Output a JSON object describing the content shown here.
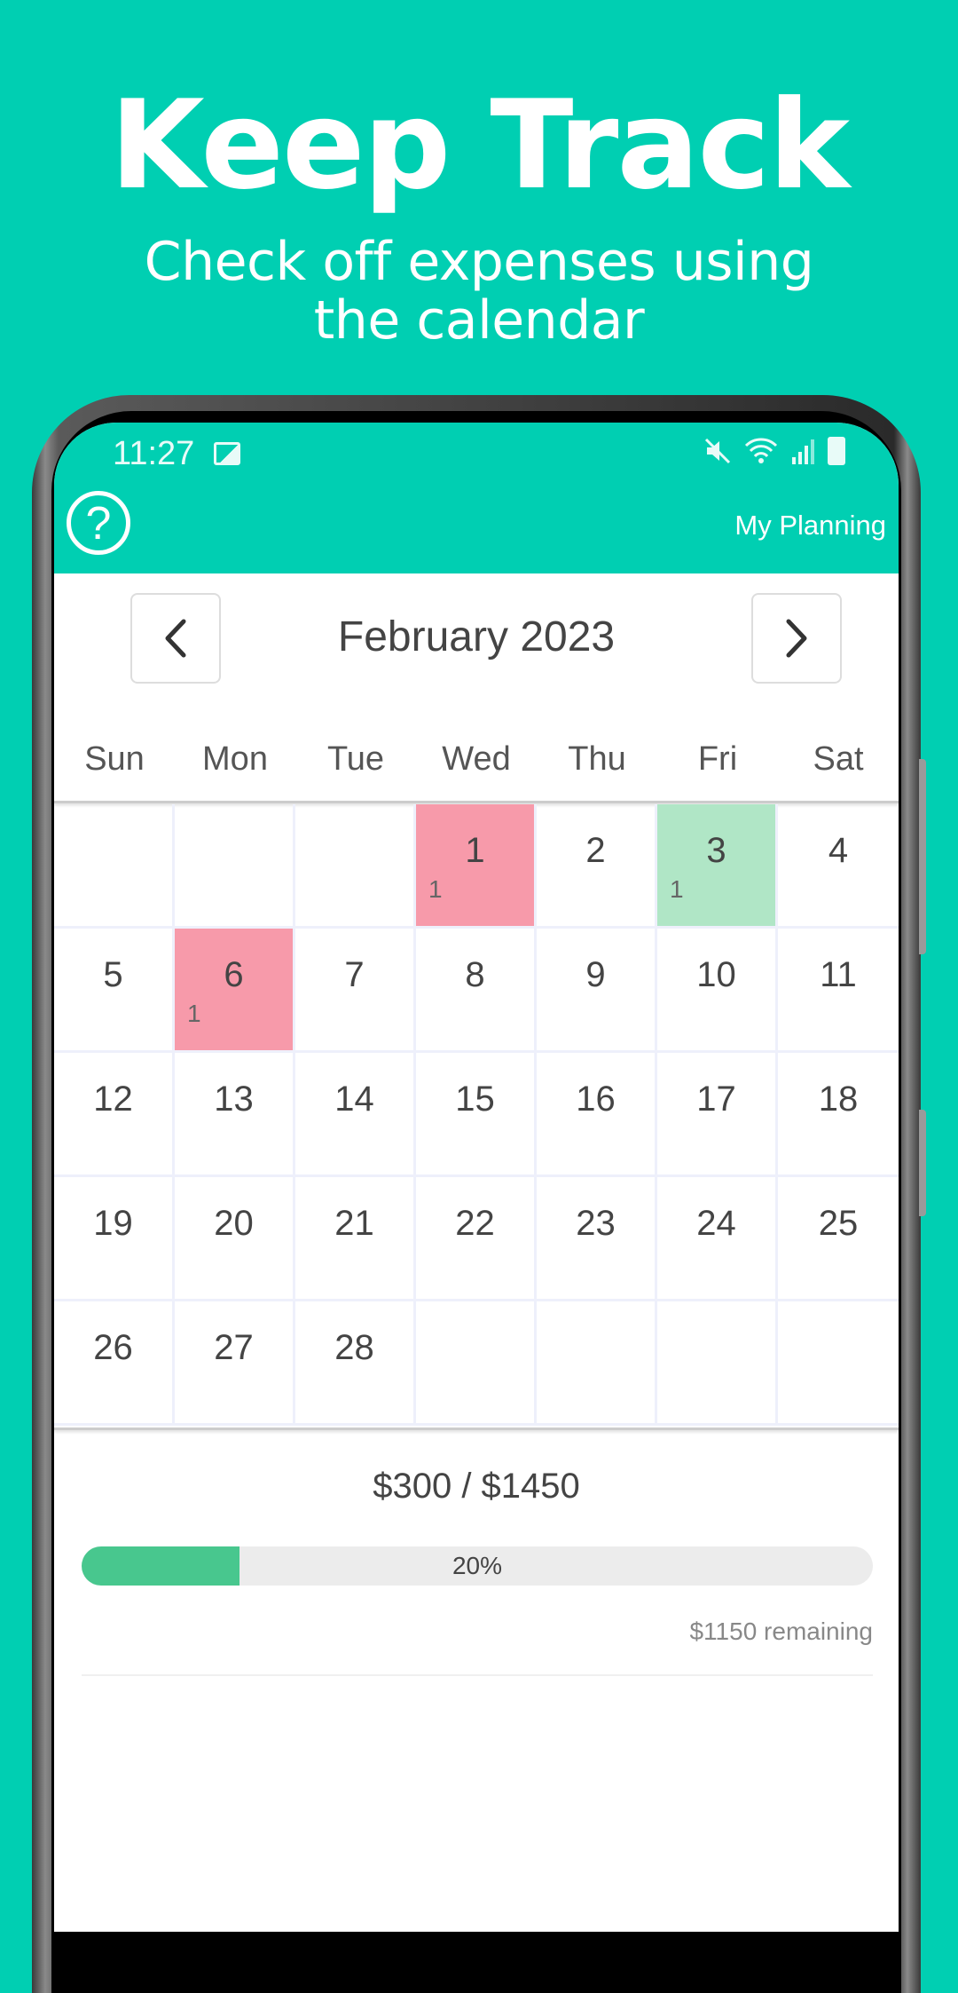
{
  "promo": {
    "title": "Keep Track",
    "subtitle_line1": "Check off expenses using",
    "subtitle_line2": "the calendar"
  },
  "status_bar": {
    "time": "11:27",
    "icons": [
      "image-icon",
      "mute-icon",
      "wifi-icon",
      "signal-icon",
      "battery-icon"
    ]
  },
  "app_bar": {
    "help_icon": "?",
    "title": "My Planning"
  },
  "calendar": {
    "month_label": "February 2023",
    "prev_icon": "chevron-left-icon",
    "next_icon": "chevron-right-icon",
    "weekdays": [
      "Sun",
      "Mon",
      "Tue",
      "Wed",
      "Thu",
      "Fri",
      "Sat"
    ],
    "cells": [
      {
        "day": "",
        "count": "",
        "status": ""
      },
      {
        "day": "",
        "count": "",
        "status": ""
      },
      {
        "day": "",
        "count": "",
        "status": ""
      },
      {
        "day": "1",
        "count": "1",
        "status": "red"
      },
      {
        "day": "2",
        "count": "",
        "status": ""
      },
      {
        "day": "3",
        "count": "1",
        "status": "green"
      },
      {
        "day": "4",
        "count": "",
        "status": ""
      },
      {
        "day": "5",
        "count": "",
        "status": ""
      },
      {
        "day": "6",
        "count": "1",
        "status": "red"
      },
      {
        "day": "7",
        "count": "",
        "status": ""
      },
      {
        "day": "8",
        "count": "",
        "status": ""
      },
      {
        "day": "9",
        "count": "",
        "status": ""
      },
      {
        "day": "10",
        "count": "",
        "status": ""
      },
      {
        "day": "11",
        "count": "",
        "status": ""
      },
      {
        "day": "12",
        "count": "",
        "status": ""
      },
      {
        "day": "13",
        "count": "",
        "status": ""
      },
      {
        "day": "14",
        "count": "",
        "status": ""
      },
      {
        "day": "15",
        "count": "",
        "status": ""
      },
      {
        "day": "16",
        "count": "",
        "status": ""
      },
      {
        "day": "17",
        "count": "",
        "status": ""
      },
      {
        "day": "18",
        "count": "",
        "status": ""
      },
      {
        "day": "19",
        "count": "",
        "status": ""
      },
      {
        "day": "20",
        "count": "",
        "status": ""
      },
      {
        "day": "21",
        "count": "",
        "status": ""
      },
      {
        "day": "22",
        "count": "",
        "status": ""
      },
      {
        "day": "23",
        "count": "",
        "status": ""
      },
      {
        "day": "24",
        "count": "",
        "status": ""
      },
      {
        "day": "25",
        "count": "",
        "status": ""
      },
      {
        "day": "26",
        "count": "",
        "status": ""
      },
      {
        "day": "27",
        "count": "",
        "status": ""
      },
      {
        "day": "28",
        "count": "",
        "status": ""
      },
      {
        "day": "",
        "count": "",
        "status": ""
      },
      {
        "day": "",
        "count": "",
        "status": ""
      },
      {
        "day": "",
        "count": "",
        "status": ""
      },
      {
        "day": "",
        "count": "",
        "status": ""
      }
    ]
  },
  "summary": {
    "budget_text": "$300 / $1450",
    "progress_percent": 20,
    "progress_label": "20%",
    "remaining_text": "$1150 remaining"
  },
  "colors": {
    "brand": "#00cfb2",
    "expense_unpaid": "#f79aaa",
    "expense_paid": "#b0e6c6",
    "progress_fill": "#48c78e"
  }
}
